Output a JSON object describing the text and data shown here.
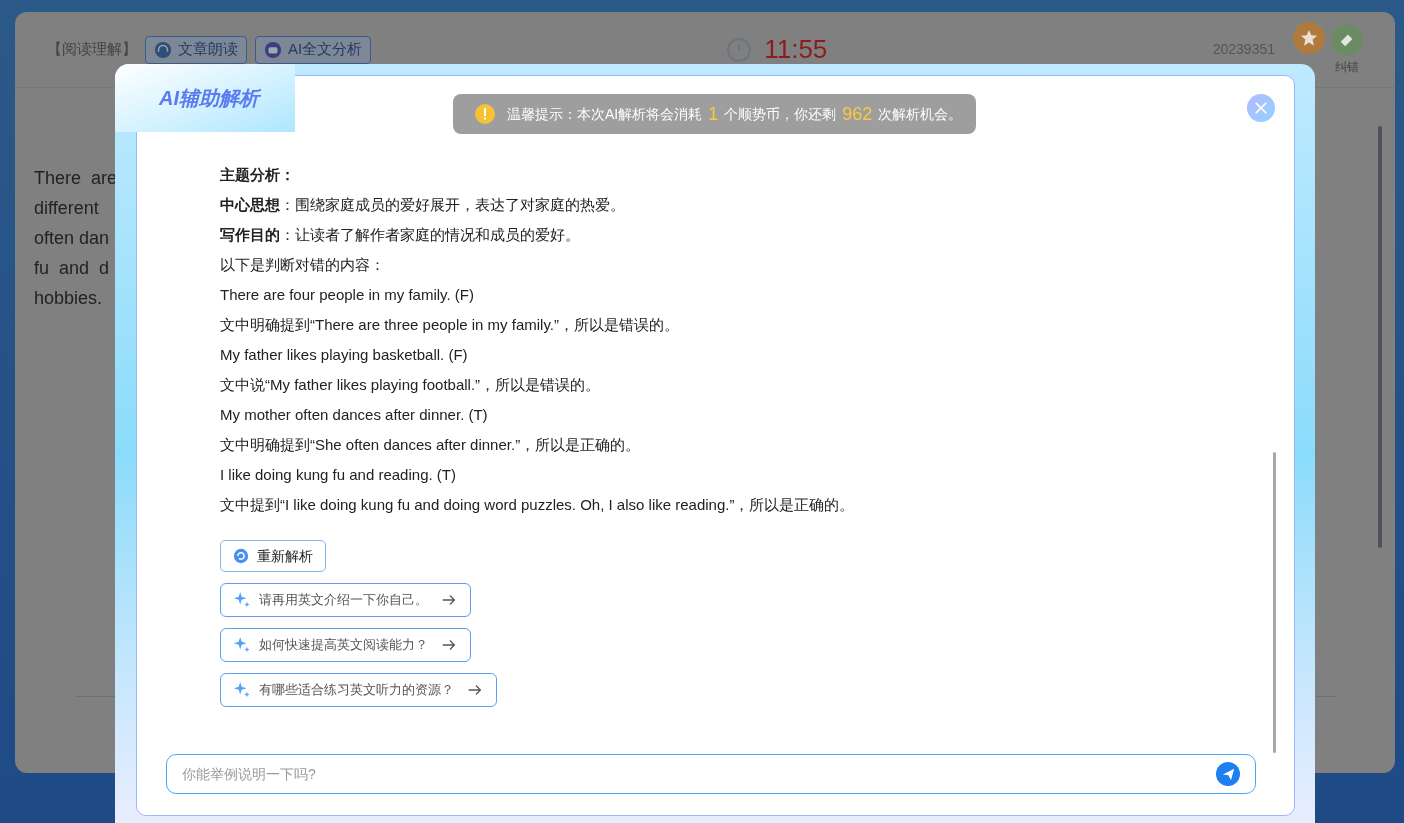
{
  "page": {
    "section_label": "【阅读理解】",
    "buttons": [
      {
        "label": "文章朗读",
        "kind": "audio"
      },
      {
        "label": "AI全文分析",
        "kind": "ai"
      }
    ],
    "timer": "11:55",
    "student_id": "20239351",
    "tools": [
      {
        "label": "纠错",
        "kind": "correct"
      }
    ],
    "passage_lines": [
      "There  are",
      "different",
      "often dan",
      "fu  and  d",
      "hobbies."
    ]
  },
  "dialog": {
    "title": "AI辅助解析",
    "notice": {
      "prefix": "温馨提示：本次AI解析将会消耗",
      "cost": "1",
      "middle": "个顺势币，你还剩",
      "remaining": "962",
      "suffix": "次解析机会。"
    },
    "lines": [
      {
        "text": "主题分析：",
        "kind": "heading"
      },
      {
        "text": "**中心思想**：围绕家庭成员的爱好展开，表达了对家庭的热爱。",
        "kind": "plain"
      },
      {
        "text": "**写作目的**：让读者了解作者家庭的情况和成员的爱好。",
        "kind": "plain"
      },
      {
        "text": "以下是判断对错的内容：",
        "kind": "plain"
      },
      {
        "text": "There are four people in my family. (F)",
        "kind": "plain"
      },
      {
        "text": "文中明确提到“There are three people in my family.”，所以是错误的。",
        "kind": "plain"
      },
      {
        "text": "My father likes playing basketball. (F)",
        "kind": "plain"
      },
      {
        "text": "文中说“My father likes playing football.”，所以是错误的。",
        "kind": "plain"
      },
      {
        "text": "My mother often dances after dinner. (T)",
        "kind": "plain"
      },
      {
        "text": "文中明确提到“She often dances after dinner.”，所以是正确的。",
        "kind": "plain"
      },
      {
        "text": "I like doing kung fu and reading. (T)",
        "kind": "plain"
      },
      {
        "text": "文中提到“I like doing kung fu and doing word puzzles. Oh, I also like reading.”，所以是正确的。",
        "kind": "plain"
      }
    ],
    "regenerate": "重新解析",
    "suggestions": [
      "请再用英文介绍一下你自己。",
      "如何快速提高英文阅读能力？",
      "有哪些适合练习英文听力的资源？"
    ],
    "input": {
      "placeholder": "你能举例说明一下吗?"
    }
  }
}
